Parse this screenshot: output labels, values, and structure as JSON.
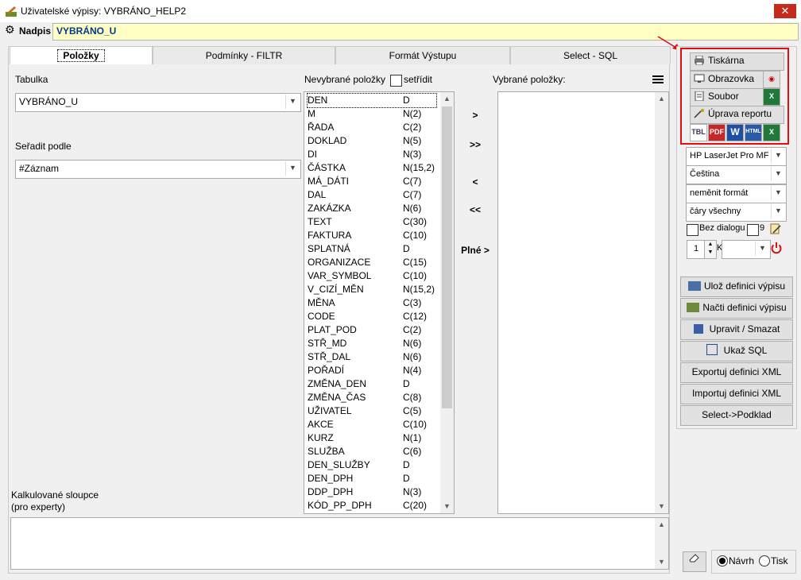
{
  "window": {
    "title": "Uživatelské výpisy: VYBRÁNO_HELP2",
    "close_label": "✕"
  },
  "header": {
    "nadpis_label": "Nadpis",
    "nadpis_value": "VYBRÁNO_U"
  },
  "tabs": [
    {
      "label": "Položky",
      "active": true
    },
    {
      "label": "Podmínky - FILTR",
      "active": false
    },
    {
      "label": "Formát Výstupu",
      "active": false
    },
    {
      "label": "Select - SQL",
      "active": false
    }
  ],
  "left": {
    "tabulka_label": "Tabulka",
    "tabulka_value": "VYBRÁNO_U",
    "seradit_label": "Seřadit podle",
    "seradit_value": "#Záznam",
    "kalk_label_1": "Kalkulované sloupce",
    "kalk_label_2": "(pro experty)"
  },
  "fields": {
    "nevybrane_label": "Nevybrané položky",
    "setridit_label": "setřídit",
    "vybrane_label": "Vybrané položky:",
    "items": [
      {
        "name": "DEN",
        "type": "D"
      },
      {
        "name": "M",
        "type": "N(2)"
      },
      {
        "name": "ŘADA",
        "type": "C(2)"
      },
      {
        "name": "DOKLAD",
        "type": "N(5)"
      },
      {
        "name": "DI",
        "type": "N(3)"
      },
      {
        "name": "ČÁSTKA",
        "type": "N(15,2)"
      },
      {
        "name": "MÁ_DÁTI",
        "type": "C(7)"
      },
      {
        "name": "DAL",
        "type": "C(7)"
      },
      {
        "name": "ZAKÁZKA",
        "type": "N(6)"
      },
      {
        "name": "TEXT",
        "type": "C(30)"
      },
      {
        "name": "FAKTURA",
        "type": "C(10)"
      },
      {
        "name": "SPLATNÁ",
        "type": "D"
      },
      {
        "name": "ORGANIZACE",
        "type": "C(15)"
      },
      {
        "name": "VAR_SYMBOL",
        "type": "C(10)"
      },
      {
        "name": "V_CIZÍ_MĚN",
        "type": "N(15,2)"
      },
      {
        "name": "MĚNA",
        "type": "C(3)"
      },
      {
        "name": "CODE",
        "type": "C(12)"
      },
      {
        "name": "PLAT_POD",
        "type": "C(2)"
      },
      {
        "name": "STŘ_MD",
        "type": "N(6)"
      },
      {
        "name": "STŘ_DAL",
        "type": "N(6)"
      },
      {
        "name": "POŘADÍ",
        "type": "N(4)"
      },
      {
        "name": "ZMĚNA_DEN",
        "type": "D"
      },
      {
        "name": "ZMĚNA_ČAS",
        "type": "C(8)"
      },
      {
        "name": "UŽIVATEL",
        "type": "C(5)"
      },
      {
        "name": "AKCE",
        "type": "C(10)"
      },
      {
        "name": "KURZ",
        "type": "N(1)"
      },
      {
        "name": "SLUŽBA",
        "type": "C(6)"
      },
      {
        "name": "DEN_SLUŽBY",
        "type": "D"
      },
      {
        "name": "DEN_DPH",
        "type": "D"
      },
      {
        "name": "DDP_DPH",
        "type": "N(3)"
      },
      {
        "name": "KÓD_PP_DPH",
        "type": "C(20)"
      }
    ]
  },
  "move": {
    "add_one": ">",
    "add_all": ">>",
    "remove_one": "<",
    "remove_all": "<<",
    "full": "Plné >"
  },
  "output": {
    "tiskarna": "Tiskárna",
    "obrazovka": "Obrazovka",
    "soubor": "Soubor",
    "uprava": "Úprava reportu",
    "fmt_icons": [
      "TBL",
      "PDF",
      "W",
      "HTML",
      "X"
    ],
    "printer": "HP LaserJet Pro MFP",
    "language": "Čeština",
    "format": "neměnit formát",
    "lines": "čáry všechny",
    "bez_dialogu": "Bez dialogu",
    "nine": "9",
    "copies": "1",
    "k_label": "K"
  },
  "actions": [
    "Ulož definici výpisu",
    "Načti definici výpisu",
    "Upravit / Smazat",
    "Ukaž SQL",
    "Exportuj definici XML",
    "Importuj definici XML",
    "Select->Podklad"
  ],
  "bottom": {
    "navrh": "Návrh",
    "tisk": "Tisk"
  },
  "colors": {
    "nadpis_bg": "#ffffc4",
    "nadpis_text": "#003a8c",
    "highlight": "#e01010"
  }
}
